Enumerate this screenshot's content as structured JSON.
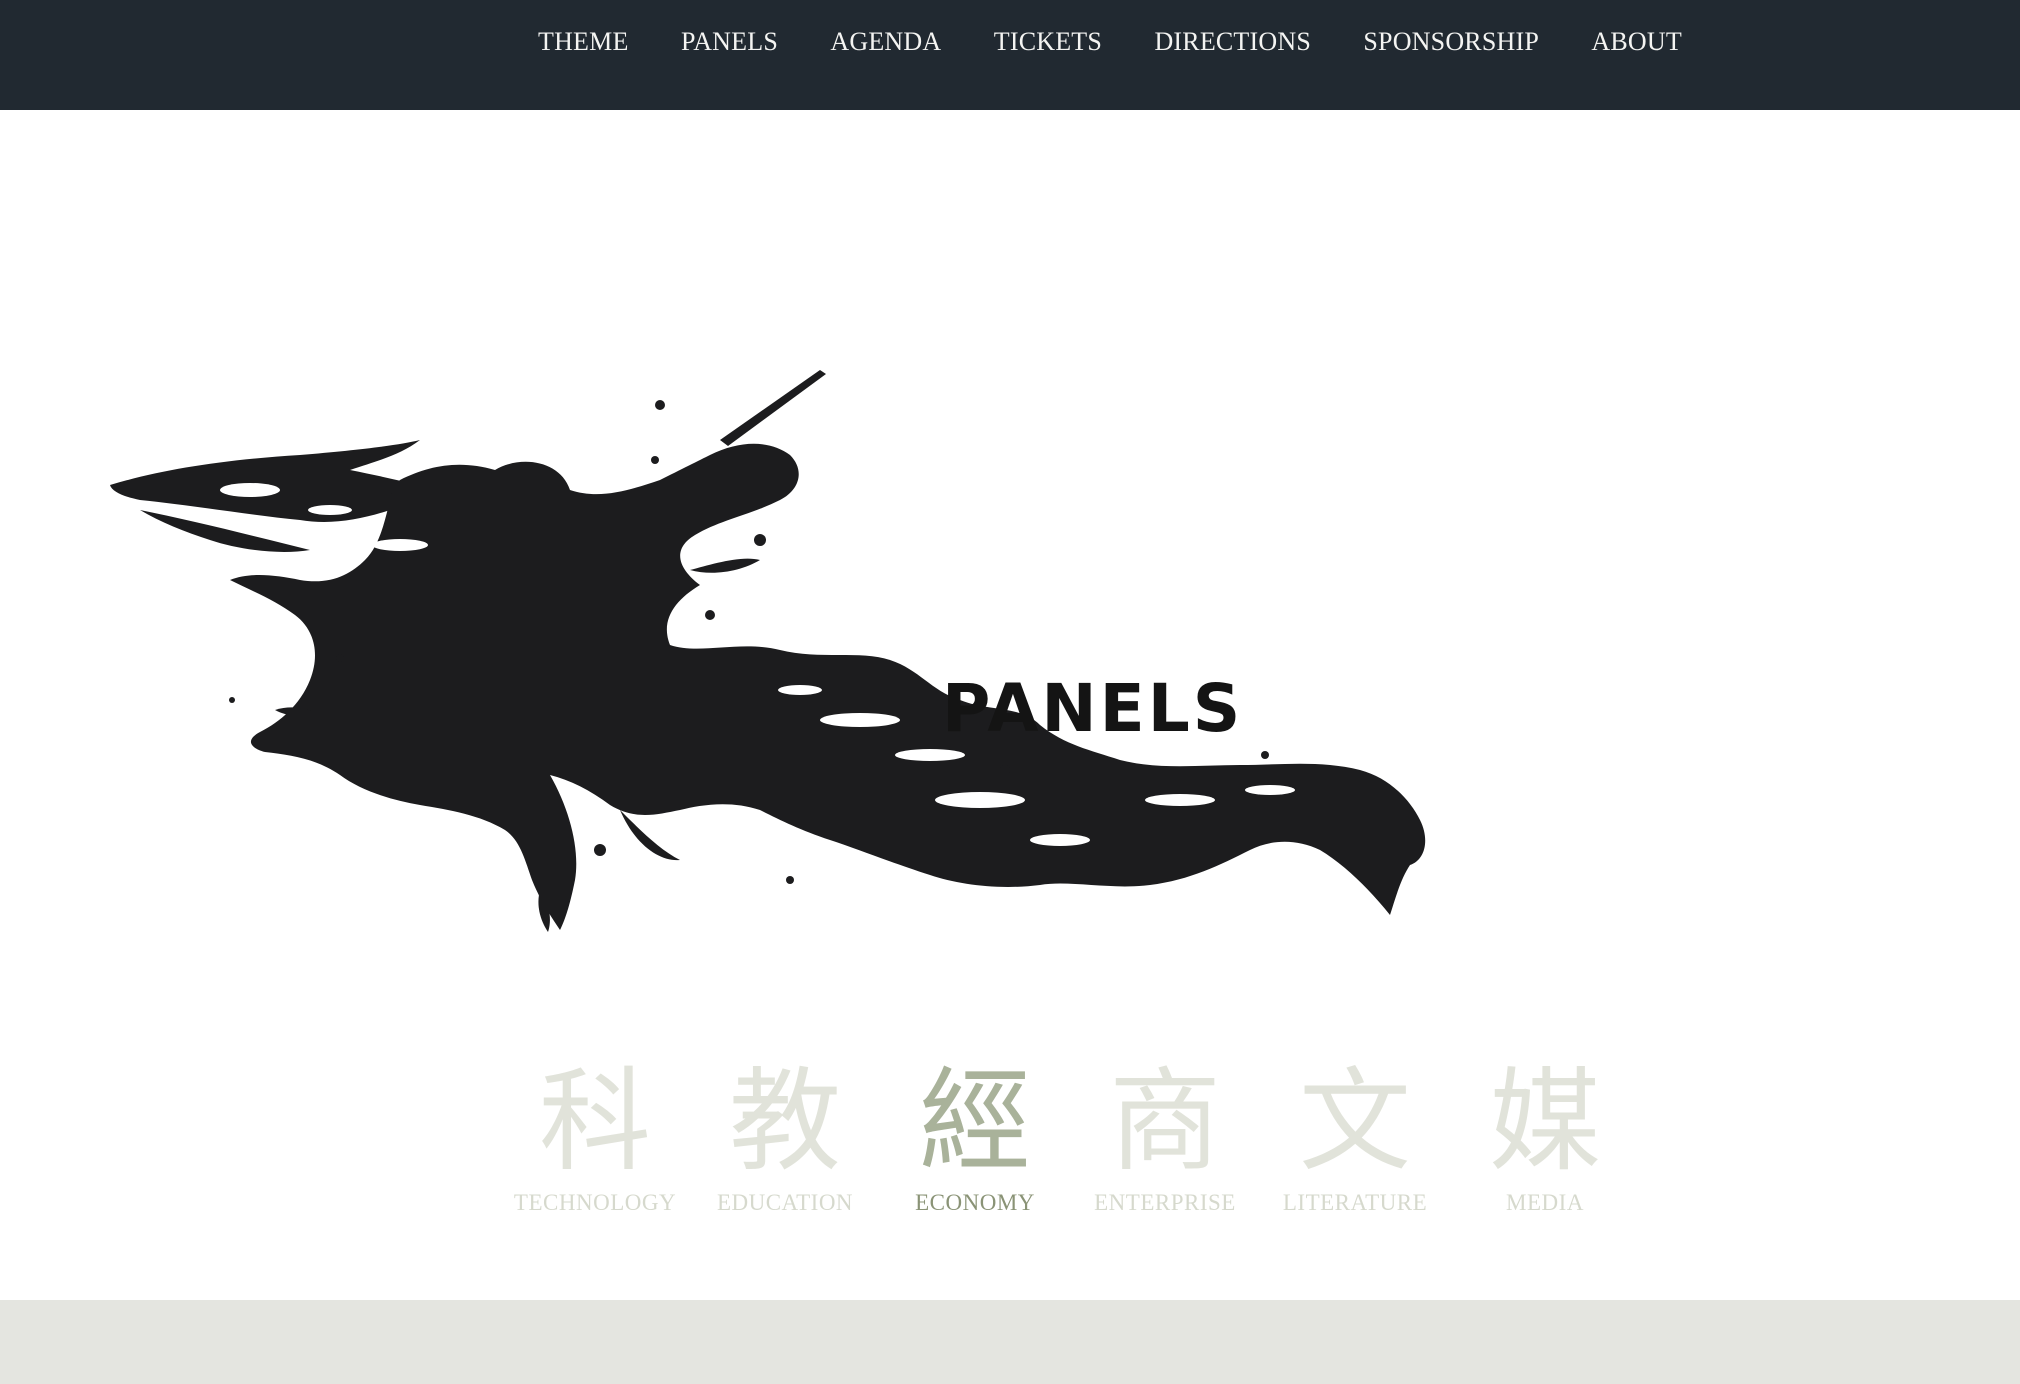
{
  "nav": {
    "items": [
      {
        "label": "THEME"
      },
      {
        "label": "PANELS"
      },
      {
        "label": "AGENDA"
      },
      {
        "label": "TICKETS"
      },
      {
        "label": "DIRECTIONS"
      },
      {
        "label": "SPONSORSHIP"
      },
      {
        "label": "ABOUT"
      }
    ]
  },
  "hero": {
    "title": "PANELS",
    "image": "ink-splash"
  },
  "categories": {
    "active_index": 2,
    "items": [
      {
        "glyph": "科",
        "label": "TECHNOLOGY"
      },
      {
        "glyph": "教",
        "label": "EDUCATION"
      },
      {
        "glyph": "經",
        "label": "ECONOMY"
      },
      {
        "glyph": "商",
        "label": "ENTERPRISE"
      },
      {
        "glyph": "文",
        "label": "LITERATURE"
      },
      {
        "glyph": "媒",
        "label": "MEDIA"
      }
    ]
  },
  "colors": {
    "navbar_bg": "#212931",
    "nav_text": "#f4f4f2",
    "ink": "#1c1c1e",
    "category_inactive": "#d6d9cd",
    "category_active": "#8a9376",
    "footer_band": "#e4e5e0"
  }
}
